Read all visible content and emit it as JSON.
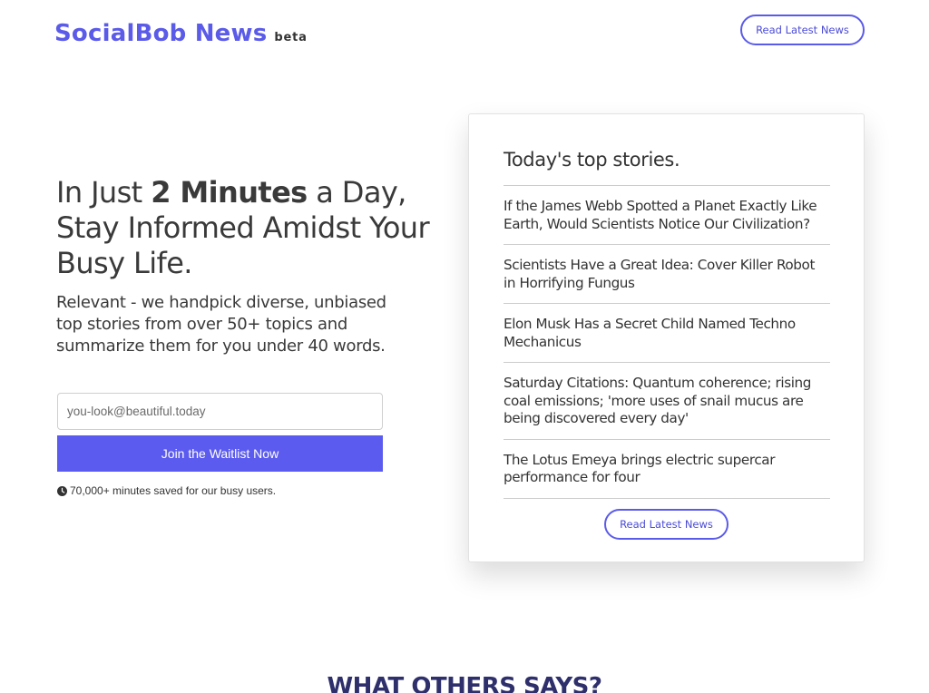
{
  "header": {
    "brand_name": "SocialBob News",
    "brand_badge": "beta",
    "cta_label": "Read Latest News"
  },
  "hero": {
    "title_part1": "In Just ",
    "title_bold": "2 Minutes",
    "title_part2": " a Day, Stay Informed Amidst Your Busy Life.",
    "subtitle": "Relevant - we handpick diverse, unbiased top stories from over 50+ topics and summarize them for you under 40 words.",
    "email_placeholder": "you-look@beautiful.today",
    "email_value": "",
    "join_label": "Join the Waitlist Now",
    "saved_note": "70,000+ minutes saved for our busy users.",
    "saved_icon": "clock-icon"
  },
  "card": {
    "title": "Today's top stories.",
    "stories": [
      "If the James Webb Spotted a Planet Exactly Like Earth, Would Scientists Notice Our Civilization?",
      "Scientists Have a Great Idea: Cover Killer Robot in Horrifying Fungus",
      "Elon Musk Has a Secret Child Named Techno Mechanicus",
      "Saturday Citations: Quantum coherence; rising coal emissions; 'more uses of snail mucus are being discovered every day'",
      "The Lotus Emeya brings electric supercar performance for four"
    ],
    "cta_label": "Read Latest News"
  },
  "testimonials": {
    "title": "WHAT OTHERS SAYS?"
  },
  "colors": {
    "brand": "#5b5be9",
    "button_fill": "#5b5bef",
    "heading_dark": "#2e2f6b",
    "text": "#333333"
  }
}
